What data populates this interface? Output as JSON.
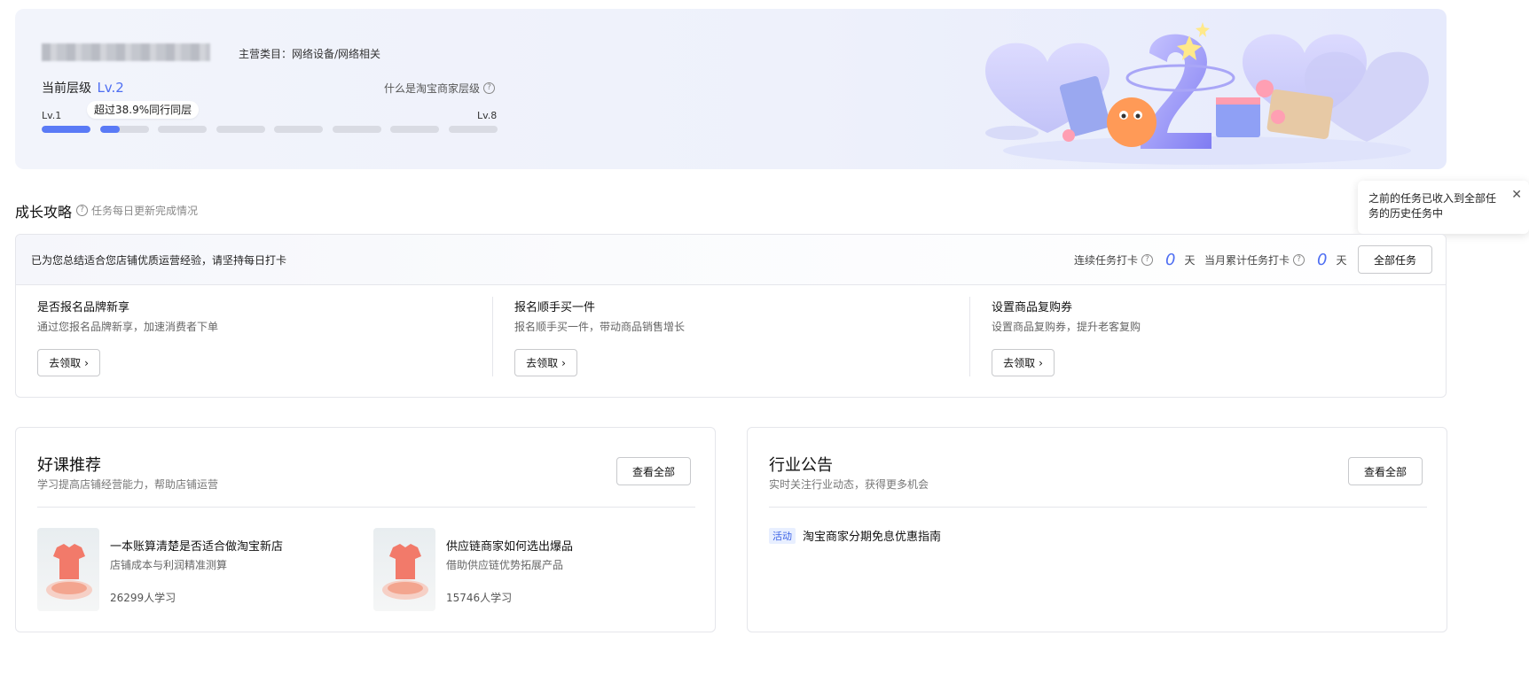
{
  "banner": {
    "category": "主营类目：网络设备/网络相关",
    "level_label": "当前层级",
    "level_value": "Lv.2",
    "what_is_level": "什么是淘宝商家层级",
    "level_start": "Lv.1",
    "level_end": "Lv.8",
    "progress_tip": "超过38.9%同行同层",
    "level_progress": [
      1,
      0.4,
      0,
      0,
      0,
      0,
      0,
      0
    ]
  },
  "growth": {
    "title": "成长攻略",
    "subtitle": "任务每日更新完成情况"
  },
  "tooltip": {
    "text": "之前的任务已收入到全部任务的历史任务中"
  },
  "task_card": {
    "header_text": "已为您总结适合您店铺优质运营经验，请坚持每日打卡",
    "streak_label": "连续任务打卡",
    "streak_value": "0",
    "monthly_label": "当月累计任务打卡",
    "monthly_value": "0",
    "day_unit": "天",
    "all_tasks_button": "全部任务",
    "tasks": [
      {
        "title": "是否报名品牌新享",
        "desc": "通过您报名品牌新享，加速消费者下单",
        "button": "去领取"
      },
      {
        "title": "报名顺手买一件",
        "desc": "报名顺手买一件，带动商品销售增长",
        "button": "去领取"
      },
      {
        "title": "设置商品复购券",
        "desc": "设置商品复购券，提升老客复购",
        "button": "去领取"
      }
    ]
  },
  "courses_card": {
    "title": "好课推荐",
    "subtitle": "学习提高店铺经营能力，帮助店铺运营",
    "view_all": "查看全部",
    "items": [
      {
        "title": "一本账算清楚是否适合做淘宝新店",
        "desc": "店铺成本与利润精准测算",
        "count": "26299人学习"
      },
      {
        "title": "供应链商家如何选出爆品",
        "desc": "借助供应链优势拓展产品",
        "count": "15746人学习"
      }
    ]
  },
  "notice_card": {
    "title": "行业公告",
    "subtitle": "实时关注行业动态，获得更多机会",
    "view_all": "查看全部",
    "items": [
      {
        "tag": "活动",
        "text": "淘宝商家分期免息优惠指南"
      }
    ]
  },
  "colors": {
    "accent": "#4e6ef2",
    "progress_fill": "#5a7af6",
    "progress_track": "#d9dbe3",
    "tag_bg": "#e8efff"
  }
}
